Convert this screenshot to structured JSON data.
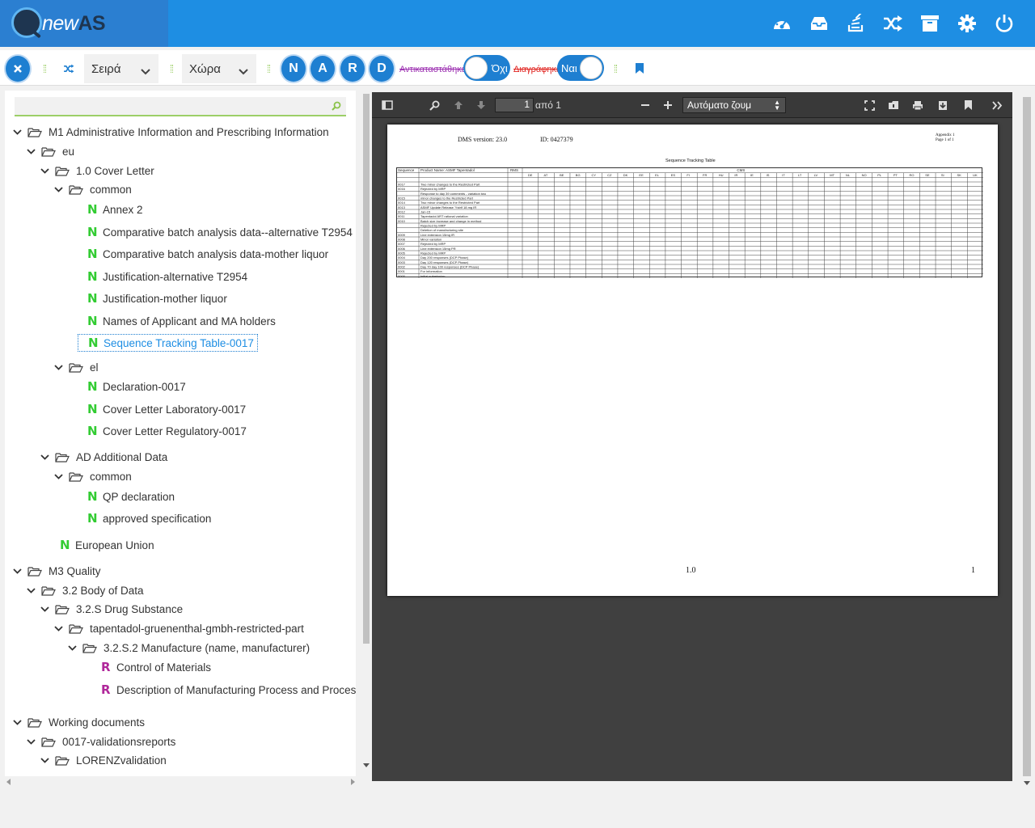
{
  "app": {
    "logo_main": "new",
    "logo_accent": "AS"
  },
  "header_icons": [
    "dashboard-icon",
    "inbox-icon",
    "stack-icon",
    "shuffle-icon",
    "archive-icon",
    "gear-icon",
    "power-icon"
  ],
  "toolbar": {
    "series_label": "Σειρά",
    "country_label": "Χώρα",
    "letter_buttons": [
      "N",
      "A",
      "R",
      "D"
    ],
    "replaced_label": "Αντικαταστάθηκε",
    "replaced_toggle": "Όχι",
    "deleted_label": "Διαγράφηκε",
    "deleted_toggle": "Ναι"
  },
  "tree": [
    {
      "label": "M1 Administrative Information and Prescribing Information",
      "kind": "folder",
      "level": 0
    },
    {
      "label": "eu",
      "kind": "folder",
      "level": 1
    },
    {
      "label": "1.0 Cover Letter",
      "kind": "folder",
      "level": 2
    },
    {
      "label": "common",
      "kind": "folder",
      "level": 3
    },
    {
      "label": "Annex 2",
      "kind": "N",
      "level": 4
    },
    {
      "label": "Comparative batch analysis data--alternative T2954",
      "kind": "N",
      "level": 4
    },
    {
      "label": "Comparative batch analysis data-mother liquor",
      "kind": "N",
      "level": 4
    },
    {
      "label": "Justification-alternative T2954",
      "kind": "N",
      "level": 4
    },
    {
      "label": "Justification-mother liquor",
      "kind": "N",
      "level": 4
    },
    {
      "label": "Names of Applicant and MA holders",
      "kind": "N",
      "level": 4
    },
    {
      "label": "Sequence Tracking Table-0017",
      "kind": "N",
      "level": 4,
      "selected": true
    },
    {
      "label": "el",
      "kind": "folder",
      "level": 3
    },
    {
      "label": "Declaration-0017",
      "kind": "N",
      "level": 4
    },
    {
      "label": "Cover Letter Laboratory-0017",
      "kind": "N",
      "level": 4
    },
    {
      "label": "Cover Letter Regulatory-0017",
      "kind": "N",
      "level": 4
    },
    {
      "label": "AD Additional Data",
      "kind": "folder",
      "level": 2
    },
    {
      "label": "common",
      "kind": "folder",
      "level": 3
    },
    {
      "label": "QP declaration",
      "kind": "N",
      "level": 4
    },
    {
      "label": "approved specification",
      "kind": "N",
      "level": 4
    },
    {
      "label": "European Union",
      "kind": "N",
      "level": 2
    },
    {
      "label": "M3 Quality",
      "kind": "folder",
      "level": 0
    },
    {
      "label": "3.2 Body of Data",
      "kind": "folder",
      "level": 1
    },
    {
      "label": "3.2.S Drug Substance",
      "kind": "folder",
      "level": 2
    },
    {
      "label": "tapentadol-gruenenthal-gmbh-restricted-part",
      "kind": "folder",
      "level": 3
    },
    {
      "label": "3.2.S.2 Manufacture (name, manufacturer)",
      "kind": "folder",
      "level": 4
    },
    {
      "label": "Control of Materials",
      "kind": "R",
      "level": 5
    },
    {
      "label": "Description of Manufacturing Process and Process Contro",
      "kind": "R",
      "level": 5
    },
    {
      "label": "Working documents",
      "kind": "folder",
      "level": 0
    },
    {
      "label": "0017-validationsreports",
      "kind": "folder",
      "level": 1
    },
    {
      "label": "LORENZvalidation",
      "kind": "folder",
      "level": 2
    }
  ],
  "viewer": {
    "page_value": "1",
    "page_of": "από 1",
    "zoom": "Αυτόματο ζουμ",
    "pdf": {
      "dms_version": "DMS version: 23.0",
      "id": "ID: 0427379",
      "appendix": "Appendix 1",
      "page_of": "Page 1 of 1",
      "table_title": "Sequence Tracking Table",
      "seq_header": "Sequence",
      "product_header": "Product Name: ASMF Tapentadol",
      "rms_header": "RMS",
      "cms_header": "CMS",
      "countries": [
        "DE",
        "AT",
        "BE",
        "BG",
        "CY",
        "CZ",
        "DK",
        "EE",
        "EL",
        "ES",
        "FI",
        "FR",
        "HU",
        "IR",
        "IE",
        "IS",
        "IT",
        "LT",
        "LV",
        "MT",
        "NL",
        "NO",
        "PL",
        "PT",
        "RO",
        "SE",
        "SI",
        "SK",
        "UK"
      ],
      "rows": [
        {
          "seq": "",
          "desc": "Submission Description"
        },
        {
          "seq": "0017",
          "desc": "Two minor changes to the Restricted Part"
        },
        {
          "seq": "0016",
          "desc": "Rejected by MRP"
        },
        {
          "seq": "",
          "desc": "Response to day 39 comments - variation two"
        },
        {
          "seq": "0015",
          "desc": "minor changes to the Restricted Part"
        },
        {
          "seq": "0014",
          "desc": "Two minor changes to the Restricted Part"
        },
        {
          "seq": "0013",
          "desc": "ASMF Update Release 'Ystrif 18 mg IR"
        },
        {
          "seq": "0012",
          "desc": "Jan-15"
        },
        {
          "seq": "0011",
          "desc": "Tapentadol ART rational variation"
        },
        {
          "seq": "0010",
          "desc": "Batch size increase and change in method"
        },
        {
          "seq": "",
          "desc": "Rejected by MRP"
        },
        {
          "seq": "",
          "desc": "Deletion of manufacturing site"
        },
        {
          "seq": "0009",
          "desc": "Line extension 15mg IR"
        },
        {
          "seq": "0008",
          "desc": "Minor variation"
        },
        {
          "seq": "0007",
          "desc": "Rejected by MRP"
        },
        {
          "seq": "0006",
          "desc": "Line extension 15mg PR"
        },
        {
          "seq": "0005",
          "desc": "Rejected by MRP"
        },
        {
          "seq": "0004",
          "desc": "Day 200 responses (DCP Phase)"
        },
        {
          "seq": "0003",
          "desc": "Day 120 responses (DCP Phase)"
        },
        {
          "seq": "0002",
          "desc": "Day 70 day 100 responses (DCP Phase)"
        },
        {
          "seq": "0001",
          "desc": "For information"
        },
        {
          "seq": "0000",
          "desc": "Initial submission"
        }
      ],
      "footer_version": "1.0",
      "footer_page": "1"
    }
  }
}
